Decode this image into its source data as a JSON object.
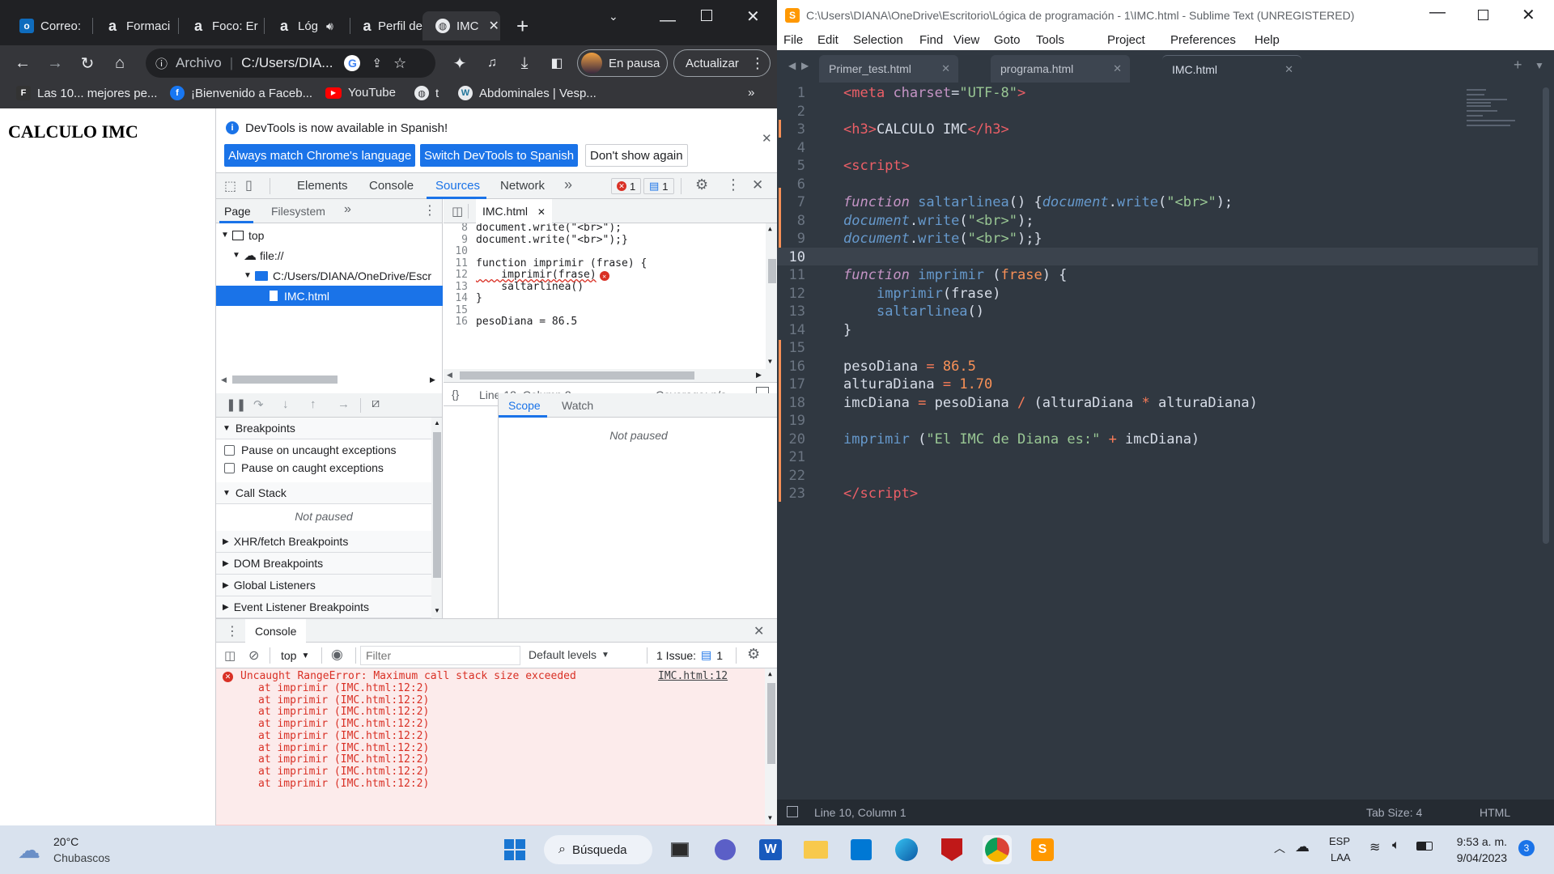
{
  "chrome": {
    "tabs": [
      {
        "label": "Correo:",
        "icon": "outlook-icon"
      },
      {
        "label": "Formaci",
        "icon": "alura-icon"
      },
      {
        "label": "Foco: Er",
        "icon": "alura-icon"
      },
      {
        "label": "Lóg",
        "icon": "alura-icon"
      },
      {
        "label": "Perfil de",
        "icon": "alura-icon"
      },
      {
        "label": "IMC",
        "icon": "globe-icon"
      }
    ],
    "address": {
      "scheme": "Archivo",
      "url": "C:/Users/DIA..."
    },
    "profile_label": "En pausa",
    "update_label": "Actualizar",
    "bookmarks": [
      {
        "label": "Las 10... mejores pe...",
        "icon": "fg-icon",
        "color": "#333333"
      },
      {
        "label": "¡Bienvenido a Faceb...",
        "icon": "facebook-icon",
        "color": "#1877f2"
      },
      {
        "label": "YouTube",
        "icon": "youtube-icon",
        "color": "#ff0000"
      },
      {
        "label": "t",
        "icon": "globe-icon",
        "color": "#5f6368"
      },
      {
        "label": "Abdominales | Vesp...",
        "icon": "wordpress-icon",
        "color": "#21759b"
      }
    ],
    "page_heading": "CALCULO IMC"
  },
  "devtools": {
    "infobar": {
      "message": "DevTools is now available in Spanish!",
      "btn1": "Always match Chrome's language",
      "btn2": "Switch DevTools to Spanish",
      "btn3": "Don't show again"
    },
    "tabs": [
      "Elements",
      "Console",
      "Sources",
      "Network"
    ],
    "error_count": "1",
    "issue_count": "1",
    "nav_tabs": [
      "Page",
      "Filesystem"
    ],
    "tree": {
      "top": "top",
      "origin": "file://",
      "folder": "C:/Users/DIANA/OneDrive/Escr",
      "file": "IMC.html"
    },
    "editor_tab": "IMC.html",
    "code_lines": [
      {
        "n": "8",
        "t": "document.write(\"<br>\");"
      },
      {
        "n": "9",
        "t": "document.write(\"<br>\");}"
      },
      {
        "n": "10",
        "t": ""
      },
      {
        "n": "11",
        "t": "function imprimir (frase) {"
      },
      {
        "n": "12",
        "t": "    imprimir(frase)"
      },
      {
        "n": "13",
        "t": "    saltarlinea()"
      },
      {
        "n": "14",
        "t": "}"
      },
      {
        "n": "15",
        "t": ""
      },
      {
        "n": "16",
        "t": "pesoDiana = 86.5"
      }
    ],
    "status": {
      "position": "Line 12, Column 2",
      "coverage": "Coverage: n/a"
    },
    "debugger": {
      "breakpoints": "Breakpoints",
      "pause_uncaught": "Pause on uncaught exceptions",
      "pause_caught": "Pause on caught exceptions",
      "call_stack": "Call Stack",
      "not_paused": "Not paused",
      "sections": [
        "XHR/fetch Breakpoints",
        "DOM Breakpoints",
        "Global Listeners",
        "Event Listener Breakpoints"
      ],
      "scope": "Scope",
      "watch": "Watch",
      "scope_not_paused": "Not paused"
    },
    "console": {
      "title": "Console",
      "context": "top",
      "filter_placeholder": "Filter",
      "levels": "Default levels",
      "issues": "1 Issue:",
      "issues_count": "1",
      "error": "Uncaught RangeError: Maximum call stack size exceeded",
      "error_link": "IMC.html:12",
      "stack_line": "at imprimir (IMC.html:12:2)",
      "stack_repeat": 9
    }
  },
  "sublime": {
    "title": "C:\\Users\\DIANA\\OneDrive\\Escritorio\\Lógica de programación - 1\\IMC.html - Sublime Text (UNREGISTERED)",
    "menu": [
      "File",
      "Edit",
      "Selection",
      "Find",
      "View",
      "Goto",
      "Tools",
      "Project",
      "Preferences",
      "Help"
    ],
    "tabs": [
      "Primer_test.html",
      "programa.html",
      "IMC.html"
    ],
    "lines": [
      "1",
      "2",
      "3",
      "4",
      "5",
      "6",
      "7",
      "8",
      "9",
      "10",
      "11",
      "12",
      "13",
      "14",
      "15",
      "16",
      "17",
      "18",
      "19",
      "20",
      "21",
      "22",
      "23"
    ],
    "status": {
      "position": "Line 10, Column 1",
      "tabsize": "Tab Size: 4",
      "syntax": "HTML"
    }
  },
  "taskbar": {
    "weather_temp": "20°C",
    "weather_desc": "Chubascos",
    "search": "Búsqueda",
    "lang": "ESP",
    "layout": "LAA",
    "time": "9:53 a. m.",
    "date": "9/04/2023",
    "notifications": "3"
  }
}
